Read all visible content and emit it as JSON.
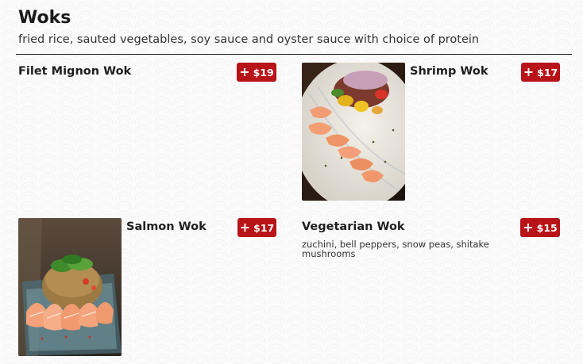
{
  "section": {
    "title": "Woks",
    "description": "fried rice, sauted vegetables, soy sauce and oyster sauce with choice of protein"
  },
  "theme": {
    "accent": "#b81318",
    "text": "#1f1f1f",
    "background": "#fbfbfb"
  },
  "items": [
    {
      "name": "Filet Mignon Wok",
      "price": "$19",
      "description": "",
      "has_image": false
    },
    {
      "name": "Shrimp Wok",
      "price": "$17",
      "description": "",
      "has_image": true
    },
    {
      "name": "Salmon Wok",
      "price": "$17",
      "description": "",
      "has_image": true
    },
    {
      "name": "Vegetarian Wok",
      "price": "$15",
      "description": "zuchini, bell peppers, snow peas, shitake mushrooms",
      "has_image": false
    }
  ],
  "icons": {
    "add": "plus-icon"
  }
}
